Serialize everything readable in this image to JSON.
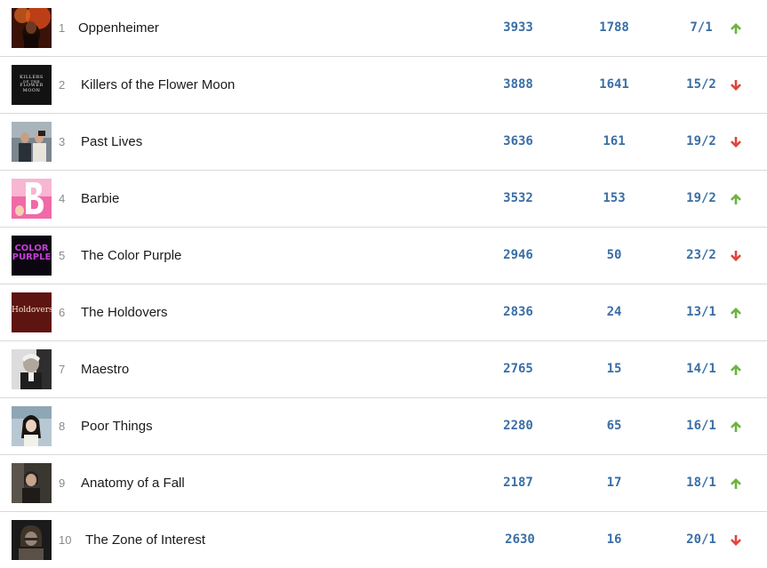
{
  "colors": {
    "up": "#6cb33f",
    "down": "#e0443a",
    "number": "#3a6ea5",
    "divider": "#d9d9d9"
  },
  "rows": [
    {
      "rank": "1",
      "title": "Oppenheimer",
      "col1": "3933",
      "col2": "1788",
      "odds": "7/1",
      "trend": "up-arrow-icon",
      "poster": "oppenheimer-poster"
    },
    {
      "rank": "2",
      "title": "Killers of the Flower Moon",
      "col1": "3888",
      "col2": "1641",
      "odds": "15/2",
      "trend": "down-arrow-icon",
      "poster": "killers-of-the-flower-moon-poster",
      "poster_text": [
        "KILLERS",
        "OF THE",
        "FLOWER MOON"
      ]
    },
    {
      "rank": "3",
      "title": "Past Lives",
      "col1": "3636",
      "col2": "161",
      "odds": "19/2",
      "trend": "down-arrow-icon",
      "poster": "past-lives-poster"
    },
    {
      "rank": "4",
      "title": "Barbie",
      "col1": "3532",
      "col2": "153",
      "odds": "19/2",
      "trend": "up-arrow-icon",
      "poster": "barbie-poster"
    },
    {
      "rank": "5",
      "title": "The Color Purple",
      "col1": "2946",
      "col2": "50",
      "odds": "23/2",
      "trend": "down-arrow-icon",
      "poster": "the-color-purple-poster",
      "poster_text": [
        "COLOR",
        "PURPLE"
      ]
    },
    {
      "rank": "6",
      "title": "The Holdovers",
      "col1": "2836",
      "col2": "24",
      "odds": "13/1",
      "trend": "up-arrow-icon",
      "poster": "the-holdovers-poster",
      "poster_text": [
        "Holdovers"
      ]
    },
    {
      "rank": "7",
      "title": "Maestro",
      "col1": "2765",
      "col2": "15",
      "odds": "14/1",
      "trend": "up-arrow-icon",
      "poster": "maestro-poster"
    },
    {
      "rank": "8",
      "title": "Poor Things",
      "col1": "2280",
      "col2": "65",
      "odds": "16/1",
      "trend": "up-arrow-icon",
      "poster": "poor-things-poster"
    },
    {
      "rank": "9",
      "title": "Anatomy of a Fall",
      "col1": "2187",
      "col2": "17",
      "odds": "18/1",
      "trend": "up-arrow-icon",
      "poster": "anatomy-of-a-fall-poster"
    },
    {
      "rank": "10",
      "title": "The Zone of Interest",
      "col1": "2630",
      "col2": "16",
      "odds": "20/1",
      "trend": "down-arrow-icon",
      "poster": "the-zone-of-interest-poster"
    }
  ]
}
